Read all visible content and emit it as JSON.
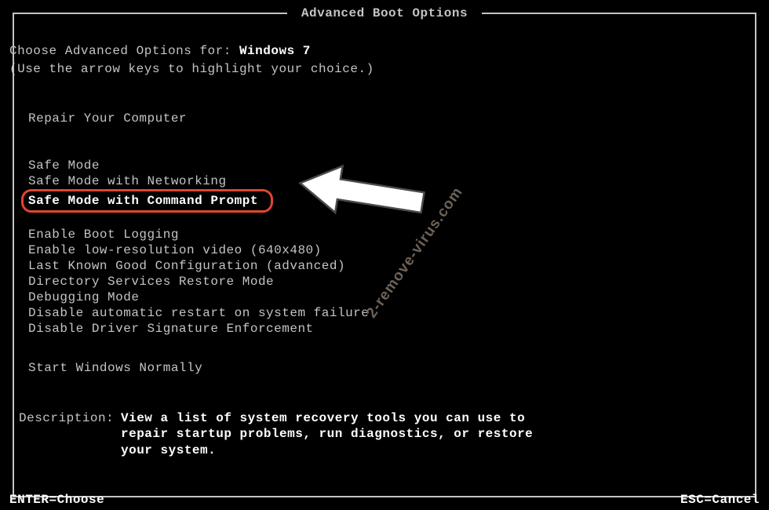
{
  "title": "Advanced Boot Options",
  "intro": {
    "prefix": "Choose Advanced Options for: ",
    "os": "Windows 7",
    "hint": "(Use the arrow keys to highlight your choice.)"
  },
  "menu": {
    "group1": [
      "Repair Your Computer"
    ],
    "group2": [
      "Safe Mode",
      "Safe Mode with Networking",
      "Safe Mode with Command Prompt"
    ],
    "group3": [
      "Enable Boot Logging",
      "Enable low-resolution video (640x480)",
      "Last Known Good Configuration (advanced)",
      "Directory Services Restore Mode",
      "Debugging Mode",
      "Disable automatic restart on system failure",
      "Disable Driver Signature Enforcement"
    ],
    "group4": [
      "Start Windows Normally"
    ]
  },
  "description": {
    "label": "Description:",
    "text": "View a list of system recovery tools you can use to repair startup problems, run diagnostics, or restore your system."
  },
  "footer": {
    "enter": "ENTER=Choose",
    "esc": "ESC=Cancel"
  },
  "watermark": "2-remove-virus.com"
}
